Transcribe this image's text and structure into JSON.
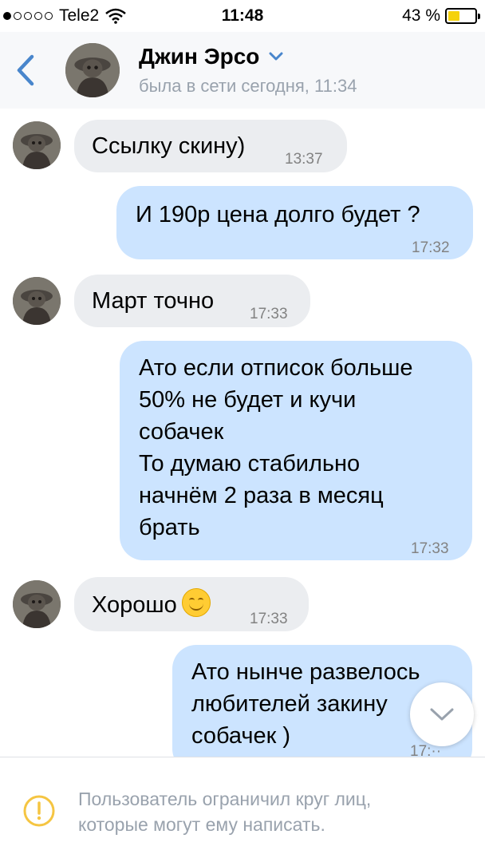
{
  "status_bar": {
    "carrier": "Tele2",
    "time": "11:48",
    "battery_percent": "43 %",
    "signal_bars_on": 1,
    "signal_bars_total": 5,
    "battery_level": 0.43,
    "battery_color": "#f5d20b"
  },
  "header": {
    "name": "Джин Эрсо",
    "last_seen": "была в сети сегодня, 11:34"
  },
  "messages": [
    {
      "dir": "in",
      "text": "Ссылку скину)",
      "time": "13:37"
    },
    {
      "dir": "out",
      "text": "И 190р цена долго будет ?",
      "time": "17:32"
    },
    {
      "dir": "in",
      "text": "Март точно",
      "time": "17:33"
    },
    {
      "dir": "out",
      "lines": [
        "Ато если отписок больше",
        "50% не будет и кучи",
        "собачек",
        "То думаю стабильно",
        "начнём 2 раза в месяц",
        "брать"
      ],
      "time": "17:33"
    },
    {
      "dir": "in",
      "text": "Хорошо",
      "emoji": "smiling-face",
      "time": "17:33"
    },
    {
      "dir": "out",
      "lines": [
        "Ато нынче развелось",
        "любителей закину",
        "собачек )"
      ],
      "time": "17:··"
    }
  ],
  "footer": {
    "notice_line1": "Пользователь ограничил круг лиц,",
    "notice_line2": "которые могут ему написать."
  },
  "colors": {
    "accent": "#4986cc",
    "incoming_bubble": "#ebedf0",
    "outgoing_bubble": "#cce4ff",
    "warning": "#f5c542"
  }
}
